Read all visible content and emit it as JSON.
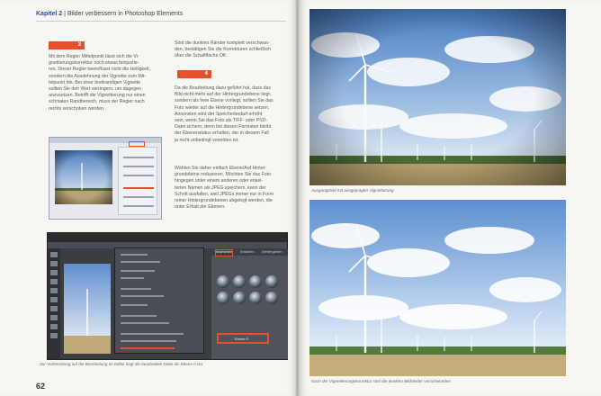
{
  "left_page": {
    "running_head": {
      "chapter": "Kapitel 2",
      "separator": " | ",
      "title": "Bilder verbessern in Photoshop Elements"
    },
    "steps": [
      {
        "number": "3"
      },
      {
        "number": "4"
      }
    ],
    "column1": [
      "Mit dem Regler Mittelpunkt lässt sich die Vi-",
      "gnettierungskorrektur noch etwas feinjustie-",
      "ren. Dieser Regler beeinflusst nicht die Helligkeit,",
      "sondern die Ausdehnung der Vignette zum Mit-",
      "telpunkt hin. Bei einer breitrandigen Vignette",
      "sollten Sie den Wert verringern, um dagegen",
      "anzusetzen. Betrifft die Vignettierung nur einen",
      "schmalen Randbereich, muss der Regler nach",
      "rechts verschoben werden."
    ],
    "column2_top": [
      "Sind die dunklen Ränder komplett verschwun-",
      "den, bestätigen Sie die Korrekturen schließlich",
      "über die Schaltfläche OK."
    ],
    "column2_step4": [
      "Da die Bearbeitung dazu geführt hat, dass das",
      "Bild nicht mehr auf der Hintergrundebene liegt,",
      "sondern als freie Ebene vorliegt, sollten Sie das",
      "Foto wieder auf die Hintergrundebene setzen.",
      "Ansonsten wird der Speicherbedarf erhöht",
      "sein, wenn Sie das Foto als TIFF- oder PSD-",
      "Datei sichern, denn bei diesen Formaten bleibt",
      "der Ebenenstatus erhalten, der in diesem Fall",
      "ja nicht unbedingt vonnöten ist."
    ],
    "column2_para2": [
      "Wählen Sie daher einfach Ebene/Auf Hinter-",
      "grundebene reduzieren. Möchten Sie das Foto",
      "hingegen unter einem anderen oder erwei-",
      "terten Namen als JPEG speichern, kann der",
      "Schritt ausfallen, weil JPEGs immer nur in Form",
      "reiner Hintergrundebenen abgelegt werden, die",
      "unter Erhalt der Ebenen."
    ],
    "caption": "Zur Vorbereitung auf die Bearbeitung im Editor liegt die bearbeitete Datei als Ebene 0 vor",
    "page_number": "62"
  },
  "editor_screenshot": {
    "panel_tabs": [
      "Bearbeiten",
      "Erstellen",
      "Weitergeben"
    ],
    "layer_label": "Ebene 0"
  },
  "right_page": {
    "caption_top": "Ausgangsbild mit ausgeprägter Vignettierung",
    "caption_bottom": "Nach der Vignettierungskorrektur sind die dunklen Bildränder verschwunden"
  },
  "colors": {
    "accent": "#e3502c",
    "heading_blue": "#2d4f8c"
  }
}
